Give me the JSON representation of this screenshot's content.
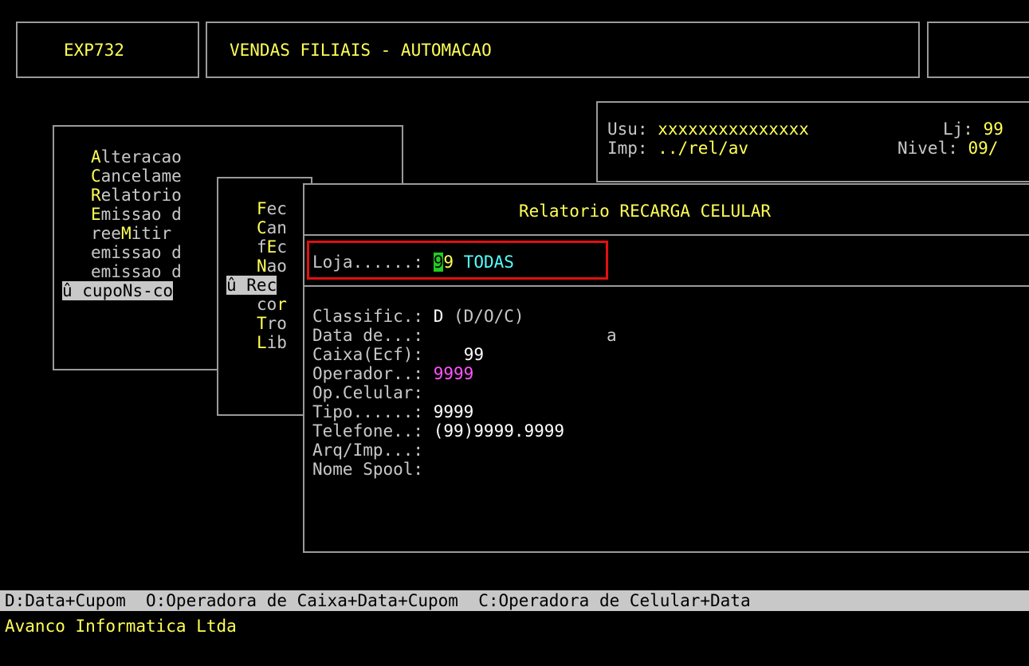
{
  "header": {
    "program_code": "EXP732",
    "program_title": "VENDAS FILIAIS - AUTOMACAO"
  },
  "user_info": {
    "usu_label": "Usu:",
    "usu_value": "xxxxxxxxxxxxxxx",
    "lj_label": "Lj:",
    "lj_value": "99",
    "imp_label": "Imp:",
    "imp_value": "../rel/av",
    "nivel_label": "Nivel:",
    "nivel_value": "09/"
  },
  "main_menu": {
    "items": [
      {
        "hot": "A",
        "rest": "lteracao"
      },
      {
        "hot": "C",
        "rest": "ancelame"
      },
      {
        "hot": "R",
        "rest": "elatorio"
      },
      {
        "hot": "E",
        "rest": "missao d"
      },
      {
        "pre": "ree",
        "hot": "M",
        "rest": "itir"
      },
      {
        "pre": "emissao d"
      },
      {
        "pre": "emissao d"
      }
    ],
    "selected": "û cupoNs-co"
  },
  "sub_menu": {
    "items": [
      {
        "hot": "F",
        "rest": "ec"
      },
      {
        "hot": "C",
        "rest": "an"
      },
      {
        "pre": "f",
        "hot": "E",
        "rest": "c"
      },
      {
        "hot": "N",
        "rest": "ao"
      }
    ],
    "selected": "û Rec",
    "items_after": [
      {
        "pre": "co",
        "hot": "r"
      },
      {
        "hot": "T",
        "rest": "ro"
      },
      {
        "hot": "L",
        "rest": "ib"
      }
    ]
  },
  "dialog": {
    "title": "Relatorio RECARGA CELULAR",
    "loja_label": "Loja......: ",
    "loja_cursor": "9",
    "loja_value_rest": "9 ",
    "loja_desc": "TODAS",
    "fields": {
      "classific_label": "Classific.: ",
      "classific_value": "D",
      "classific_hint": " (D/O/C)",
      "data_label": "Data de...: ",
      "data_sep": "a",
      "caixa_label": "Caixa(Ecf): ",
      "caixa_value": "99",
      "operador_label": "Operador..: ",
      "operador_value": "9999",
      "opcelular_label": "Op.Celular:",
      "tipo_label": "Tipo......: ",
      "tipo_value": "9999",
      "telefone_label": "Telefone..: ",
      "telefone_value": "(99)9999.9999",
      "arqimp_label": "Arq/Imp...:",
      "nomespool_label": "Nome Spool:"
    }
  },
  "status_bar": {
    "help_line": "D:Data+Cupom  O:Operadora de Caixa+Data+Cupom  C:Operadora de Celular+Data",
    "company": "Avanco Informatica Ltda"
  }
}
